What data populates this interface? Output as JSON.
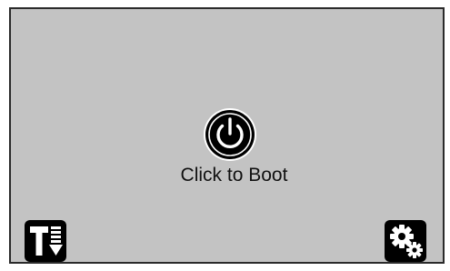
{
  "boot_screen": {
    "label": "Click to Boot",
    "power_icon": "power-icon",
    "left_button_icon": "text-download-icon",
    "right_button_icon": "settings-gears-icon"
  },
  "colors": {
    "background": "#c3c3c3",
    "button": "#000000",
    "icon": "#ffffff"
  }
}
